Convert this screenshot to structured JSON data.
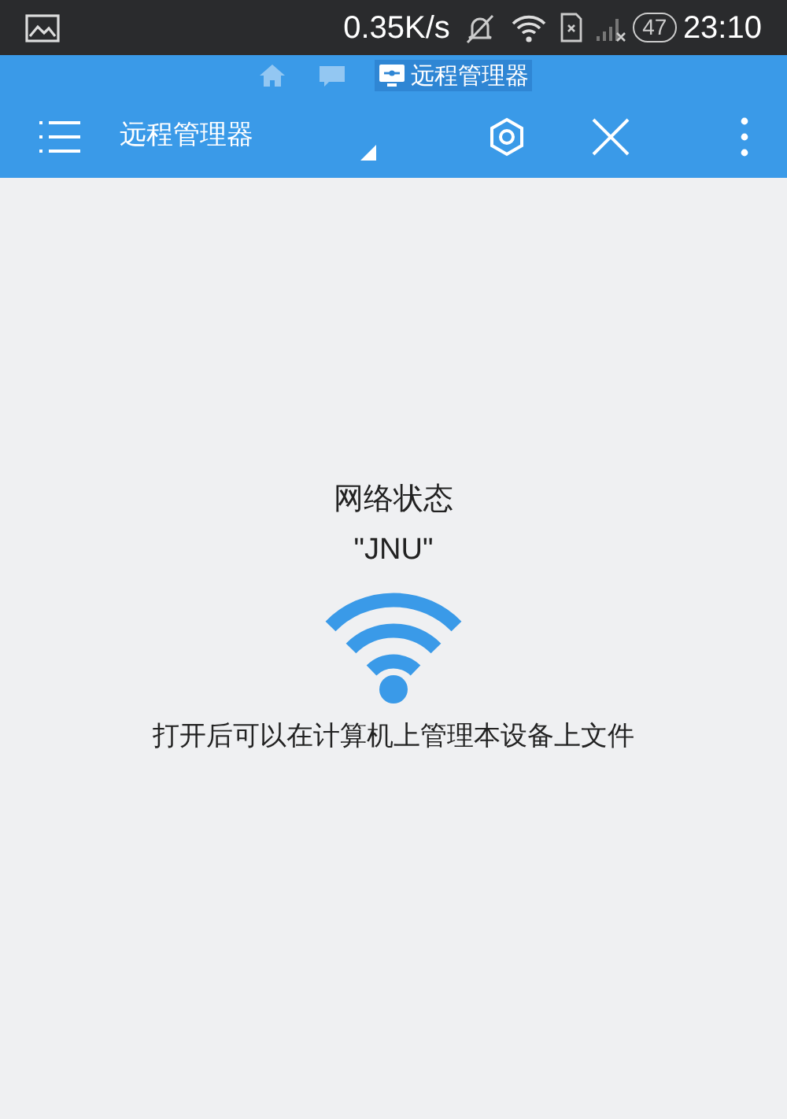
{
  "status_bar": {
    "speed": "0.35K/s",
    "battery": "47",
    "time": "23:10"
  },
  "breadcrumbs": [
    {
      "kind": "home",
      "selected": false
    },
    {
      "kind": "window",
      "selected": false
    },
    {
      "kind": "remote",
      "label": "远程管理器",
      "selected": true
    }
  ],
  "toolbar": {
    "title": "远程管理器"
  },
  "content": {
    "heading": "网络状态",
    "network": "\"JNU\"",
    "hint": "打开后可以在计算机上管理本设备上文件"
  }
}
